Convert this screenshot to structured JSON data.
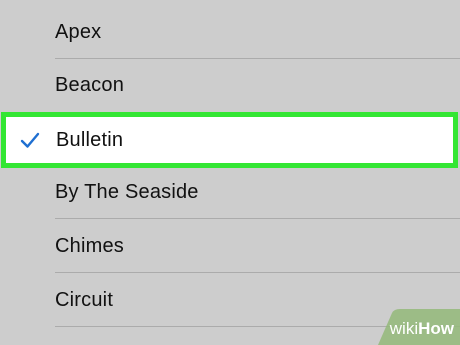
{
  "ringtone_list": {
    "items": [
      {
        "label": "Apex",
        "selected": false
      },
      {
        "label": "Beacon",
        "selected": false
      },
      {
        "label": "Bulletin",
        "selected": true
      },
      {
        "label": "By The Seaside",
        "selected": false
      },
      {
        "label": "Chimes",
        "selected": false
      },
      {
        "label": "Circuit",
        "selected": false
      }
    ]
  },
  "icons": {
    "selected_indicator": "checkmark-icon"
  },
  "colors": {
    "background": "#cdcdcd",
    "selected_row": "#ffffff",
    "highlight_border": "#33e633",
    "checkmark": "#1f6fd1"
  },
  "watermark": {
    "wiki": "wiki",
    "how": "How"
  }
}
